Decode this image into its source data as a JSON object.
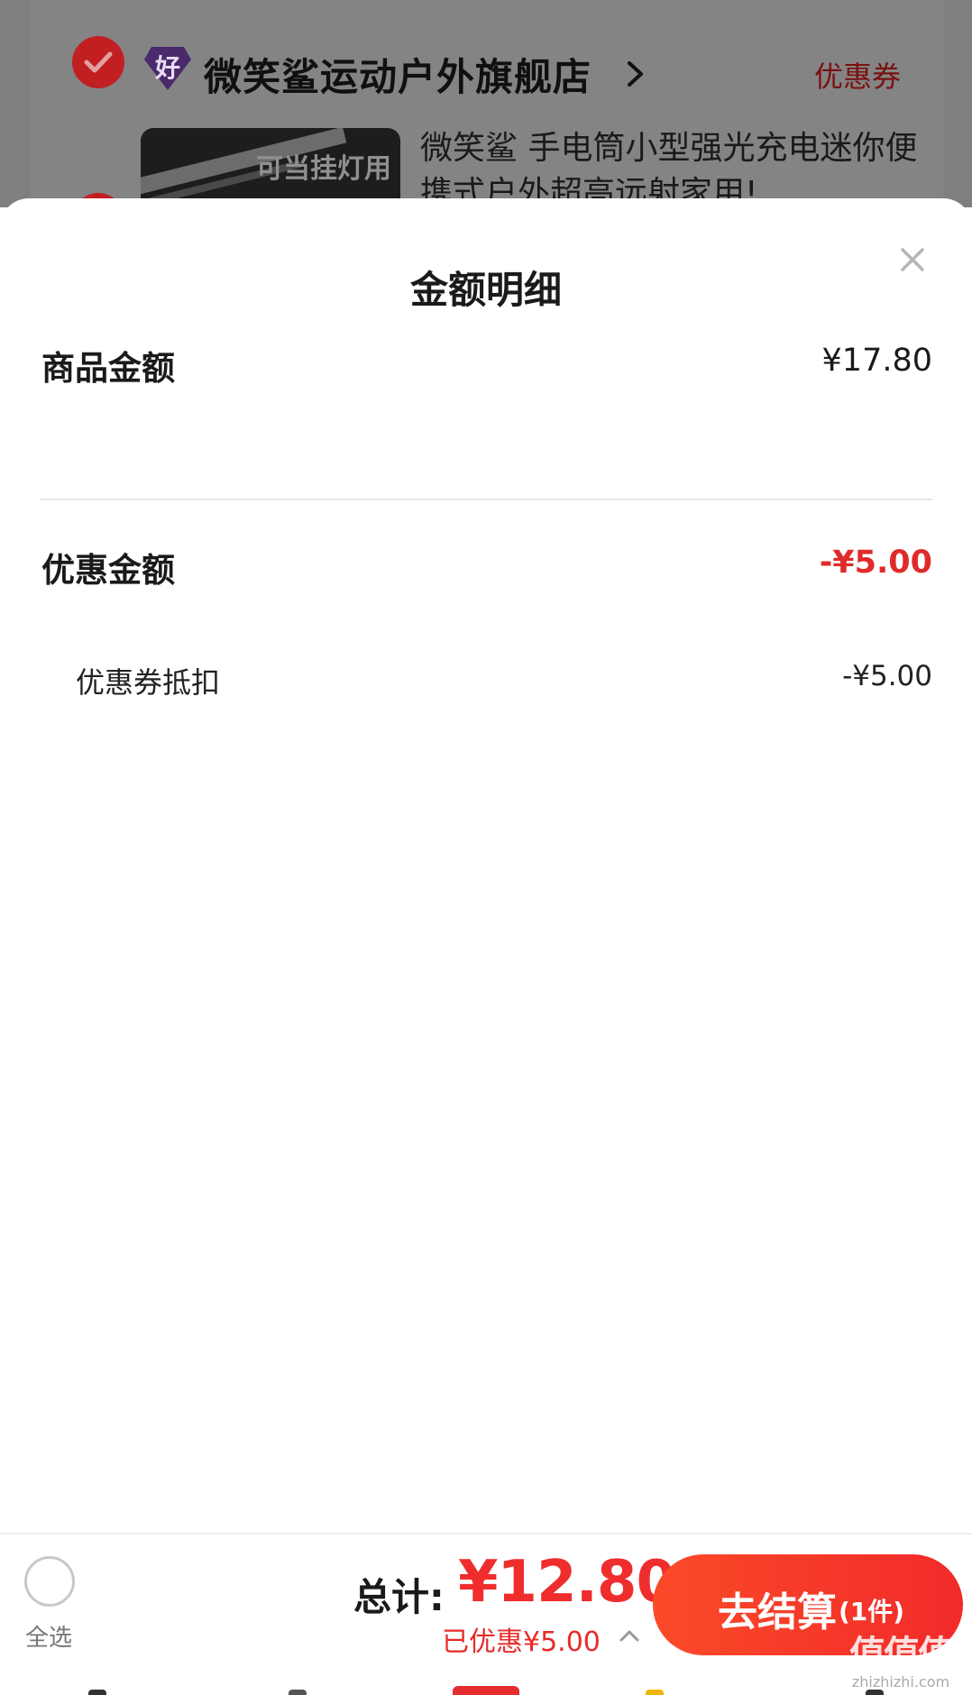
{
  "background": {
    "shop": {
      "name": "微笑鲨运动户外旗舰店",
      "badge": "好",
      "coupon_link": "优惠券"
    },
    "product": {
      "thumb_text": "可当挂灯用",
      "title": "微笑鲨 手电筒小型强光充电迷你便携式户外超高远射家用!"
    }
  },
  "sheet": {
    "title": "金额明细",
    "close_icon": "close-icon",
    "rows": {
      "goods_amount": {
        "label": "商品金额",
        "value": "¥17.80"
      },
      "discount_amount": {
        "label": "优惠金额",
        "value": "-¥5.00"
      },
      "coupon_deduction": {
        "label": "优惠券抵扣",
        "value": "-¥5.00"
      }
    }
  },
  "bottom_bar": {
    "select_all": "全选",
    "total_label": "总计:",
    "total_value": "¥12.80",
    "saved": "已优惠¥5.00",
    "checkout": {
      "label": "去结算",
      "count": "(1件)"
    }
  },
  "watermark": {
    "main": "值值值",
    "sub": "zhizhizhi.com"
  },
  "colors": {
    "accent_red": "#ef2d2d",
    "discount_red": "#e02a2a",
    "checkout_gradient_start": "#fb4a28",
    "checkout_gradient_end": "#f12a2a"
  }
}
